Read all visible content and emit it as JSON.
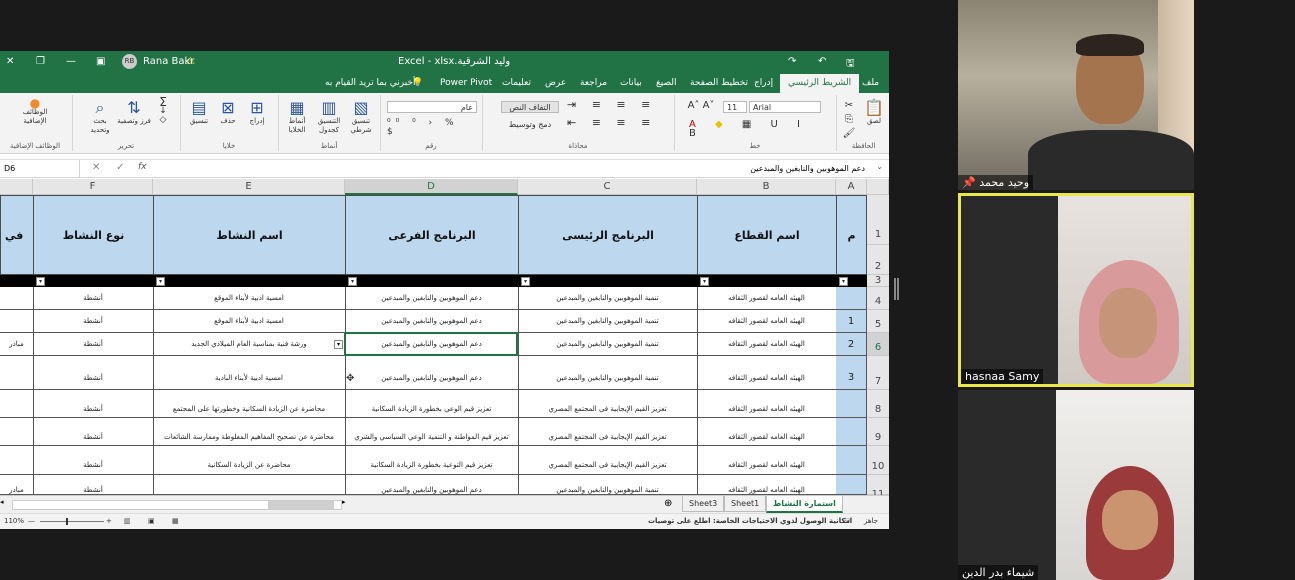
{
  "excel": {
    "title": "Excel  -  xlsx.وليد الشرقية",
    "user_name": "Rana Bakr",
    "user_initials": "RB",
    "ribbon_tabs": [
      "ملف",
      "الشريط الرئيسي",
      "إدراج",
      "تخطيط الصفحة",
      "الصيغ",
      "بيانات",
      "مراجعة",
      "عرض",
      "تعليمات",
      "Power Pivot"
    ],
    "tell_me": "أخبرني بما تريد القيام به",
    "groups": {
      "clipboard": "الحافظة",
      "font": "خط",
      "alignment": "محاذاة",
      "number": "رقم",
      "styles": "أنماط",
      "cells": "خلايا",
      "editing": "تحرير",
      "addins": "الوظائف الإضافية"
    },
    "ribbon_buttons": {
      "paste": "لصق",
      "wrap_text": "التفاف النص",
      "merge_center": "دمج وتوسيط",
      "conditional_format": "تنسيق شرطي",
      "format_as_table": "التنسيق كجدول",
      "cell_styles": "أنماط الخلايا",
      "insert": "إدراج",
      "delete": "حذف",
      "format": "تنسيق",
      "sort_filter": "فرز وتصفية",
      "find_select": "بحث وتحديد",
      "addins": "الوظائف الإضافية"
    },
    "font_name": "Arial",
    "font_size": "11",
    "number_format": "عام",
    "name_box": "D6",
    "formula": "دعم الموهوبين والنابغين والمبدعين",
    "columns": [
      "F",
      "E",
      "D",
      "C",
      "B",
      "A"
    ],
    "headers": {
      "num": "م",
      "sector": "اسم القطاع",
      "main_program": "البرنامج الرئيسى",
      "sub_program": "البرنامج الفرعى",
      "activity_name": "اسم النشاط",
      "activity_type": "نوع النشاط",
      "partial": "في"
    },
    "row_numbers": [
      "1",
      "2",
      "3",
      "4",
      "5",
      "6",
      "7",
      "8",
      "9",
      "10",
      "11"
    ],
    "rows": [
      {
        "num": "",
        "sector": "الهيئه العامه لقصور الثقافه",
        "main": "تنمية الموهوبين والنابغين والمبدعين",
        "sub": "دعم الموهوبين والنابغين والمبدعين",
        "activity": "امسية ادبية لأبناء الموقع",
        "type": "أنشطة"
      },
      {
        "num": "1",
        "sector": "الهيئه العامه لقصور الثقافه",
        "main": "تنمية الموهوبين والنابغين والمبدعين",
        "sub": "دعم الموهوبين والنابغين والمبدعين",
        "activity": "امسية ادبية لأبناء الموقع",
        "type": "أنشطة"
      },
      {
        "num": "2",
        "sector": "الهيئه العامه لقصور الثقافه",
        "main": "تنمية الموهوبين والنابغين والمبدعين",
        "sub": "دعم الموهوبين والنابغين والمبدعين",
        "activity": "ورشة فنية بمناسبة العام الميلادي الجديد",
        "type": "أنشطة"
      },
      {
        "num": "3",
        "sector": "الهيئه العامه لقصور الثقافه",
        "main": "تنمية الموهوبين والنابغين والمبدعين",
        "sub": "دعم الموهوبين والنابغين والمبدعين",
        "activity": "امسية ادبية لأبناء البادية",
        "type": "أنشطة"
      },
      {
        "num": "",
        "sector": "الهيئه العامه لقصور الثقافه",
        "main": "تعزيز القيم الإيجابية فى المجتمع المصري",
        "sub": "تعزيز قيم الوعي بخطورة الزيادة السكانية",
        "activity": "محاضرة عن الزيادة السكانية وخطورتها على المجتمع",
        "type": "أنشطة"
      },
      {
        "num": "",
        "sector": "الهيئه العامه لقصور الثقافه",
        "main": "تعزيز القيم الإيجابية فى المجتمع المصري",
        "sub": "تعزيز قيم المواطنة و التنمية الوعي السياسي والشري",
        "activity": "محاضرة عن تصحيح المفاهيم المغلوطة وممارسة الشائعات",
        "type": "أنشطة"
      },
      {
        "num": "",
        "sector": "الهيئه العامه لقصور الثقافه",
        "main": "تعزيز القيم الإيجابية فى المجتمع المصري",
        "sub": "تعزيز قيم التوعية بخطورة الزيادة السكانية",
        "activity": "محاضرة عن الزيادة السكانية",
        "type": "أنشطة"
      },
      {
        "num": "",
        "sector": "الهيئه العامه لقصور الثقافه",
        "main": "تنمية الموهوبين والنابغين والمبدعين",
        "sub": "دعم الموهوبين والنابغين والمبدعين",
        "activity": "",
        "type": "أنشطة"
      }
    ],
    "partial_cells": [
      "",
      "",
      "مبادر",
      "",
      "",
      "",
      "",
      "مبادر"
    ],
    "sheet_tabs": [
      "استمارة النشاط",
      "Sheet1",
      "Sheet3"
    ],
    "status": {
      "ready": "جاهز",
      "accessibility": "امكانية الوصول لذوي الاحتياجات الخاصة: اطلع على توصيات",
      "zoom": "110%"
    }
  },
  "participants": [
    {
      "name": "وحيد محمد",
      "muted": false
    },
    {
      "name": "hasnaa Samy",
      "active_speaker": true
    },
    {
      "name": "شيماء بدر الدين"
    }
  ],
  "colors": {
    "excel_green": "#217346",
    "header_fill": "#bdd7ee",
    "active_speaker_border": "#e8e84a"
  }
}
